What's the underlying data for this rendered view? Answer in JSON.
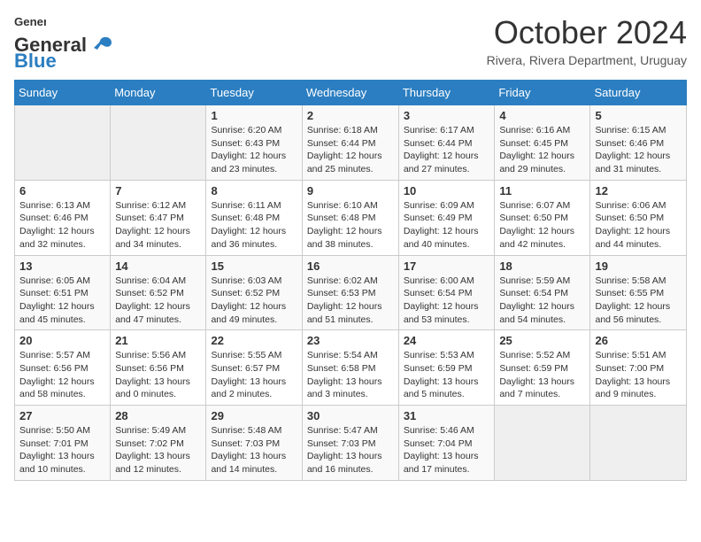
{
  "header": {
    "logo_general": "General",
    "logo_blue": "Blue",
    "month_year": "October 2024",
    "location": "Rivera, Rivera Department, Uruguay"
  },
  "weekdays": [
    "Sunday",
    "Monday",
    "Tuesday",
    "Wednesday",
    "Thursday",
    "Friday",
    "Saturday"
  ],
  "weeks": [
    [
      {
        "day": "",
        "info": ""
      },
      {
        "day": "",
        "info": ""
      },
      {
        "day": "1",
        "info": "Sunrise: 6:20 AM\nSunset: 6:43 PM\nDaylight: 12 hours and 23 minutes."
      },
      {
        "day": "2",
        "info": "Sunrise: 6:18 AM\nSunset: 6:44 PM\nDaylight: 12 hours and 25 minutes."
      },
      {
        "day": "3",
        "info": "Sunrise: 6:17 AM\nSunset: 6:44 PM\nDaylight: 12 hours and 27 minutes."
      },
      {
        "day": "4",
        "info": "Sunrise: 6:16 AM\nSunset: 6:45 PM\nDaylight: 12 hours and 29 minutes."
      },
      {
        "day": "5",
        "info": "Sunrise: 6:15 AM\nSunset: 6:46 PM\nDaylight: 12 hours and 31 minutes."
      }
    ],
    [
      {
        "day": "6",
        "info": "Sunrise: 6:13 AM\nSunset: 6:46 PM\nDaylight: 12 hours and 32 minutes."
      },
      {
        "day": "7",
        "info": "Sunrise: 6:12 AM\nSunset: 6:47 PM\nDaylight: 12 hours and 34 minutes."
      },
      {
        "day": "8",
        "info": "Sunrise: 6:11 AM\nSunset: 6:48 PM\nDaylight: 12 hours and 36 minutes."
      },
      {
        "day": "9",
        "info": "Sunrise: 6:10 AM\nSunset: 6:48 PM\nDaylight: 12 hours and 38 minutes."
      },
      {
        "day": "10",
        "info": "Sunrise: 6:09 AM\nSunset: 6:49 PM\nDaylight: 12 hours and 40 minutes."
      },
      {
        "day": "11",
        "info": "Sunrise: 6:07 AM\nSunset: 6:50 PM\nDaylight: 12 hours and 42 minutes."
      },
      {
        "day": "12",
        "info": "Sunrise: 6:06 AM\nSunset: 6:50 PM\nDaylight: 12 hours and 44 minutes."
      }
    ],
    [
      {
        "day": "13",
        "info": "Sunrise: 6:05 AM\nSunset: 6:51 PM\nDaylight: 12 hours and 45 minutes."
      },
      {
        "day": "14",
        "info": "Sunrise: 6:04 AM\nSunset: 6:52 PM\nDaylight: 12 hours and 47 minutes."
      },
      {
        "day": "15",
        "info": "Sunrise: 6:03 AM\nSunset: 6:52 PM\nDaylight: 12 hours and 49 minutes."
      },
      {
        "day": "16",
        "info": "Sunrise: 6:02 AM\nSunset: 6:53 PM\nDaylight: 12 hours and 51 minutes."
      },
      {
        "day": "17",
        "info": "Sunrise: 6:00 AM\nSunset: 6:54 PM\nDaylight: 12 hours and 53 minutes."
      },
      {
        "day": "18",
        "info": "Sunrise: 5:59 AM\nSunset: 6:54 PM\nDaylight: 12 hours and 54 minutes."
      },
      {
        "day": "19",
        "info": "Sunrise: 5:58 AM\nSunset: 6:55 PM\nDaylight: 12 hours and 56 minutes."
      }
    ],
    [
      {
        "day": "20",
        "info": "Sunrise: 5:57 AM\nSunset: 6:56 PM\nDaylight: 12 hours and 58 minutes."
      },
      {
        "day": "21",
        "info": "Sunrise: 5:56 AM\nSunset: 6:56 PM\nDaylight: 13 hours and 0 minutes."
      },
      {
        "day": "22",
        "info": "Sunrise: 5:55 AM\nSunset: 6:57 PM\nDaylight: 13 hours and 2 minutes."
      },
      {
        "day": "23",
        "info": "Sunrise: 5:54 AM\nSunset: 6:58 PM\nDaylight: 13 hours and 3 minutes."
      },
      {
        "day": "24",
        "info": "Sunrise: 5:53 AM\nSunset: 6:59 PM\nDaylight: 13 hours and 5 minutes."
      },
      {
        "day": "25",
        "info": "Sunrise: 5:52 AM\nSunset: 6:59 PM\nDaylight: 13 hours and 7 minutes."
      },
      {
        "day": "26",
        "info": "Sunrise: 5:51 AM\nSunset: 7:00 PM\nDaylight: 13 hours and 9 minutes."
      }
    ],
    [
      {
        "day": "27",
        "info": "Sunrise: 5:50 AM\nSunset: 7:01 PM\nDaylight: 13 hours and 10 minutes."
      },
      {
        "day": "28",
        "info": "Sunrise: 5:49 AM\nSunset: 7:02 PM\nDaylight: 13 hours and 12 minutes."
      },
      {
        "day": "29",
        "info": "Sunrise: 5:48 AM\nSunset: 7:03 PM\nDaylight: 13 hours and 14 minutes."
      },
      {
        "day": "30",
        "info": "Sunrise: 5:47 AM\nSunset: 7:03 PM\nDaylight: 13 hours and 16 minutes."
      },
      {
        "day": "31",
        "info": "Sunrise: 5:46 AM\nSunset: 7:04 PM\nDaylight: 13 hours and 17 minutes."
      },
      {
        "day": "",
        "info": ""
      },
      {
        "day": "",
        "info": ""
      }
    ]
  ]
}
